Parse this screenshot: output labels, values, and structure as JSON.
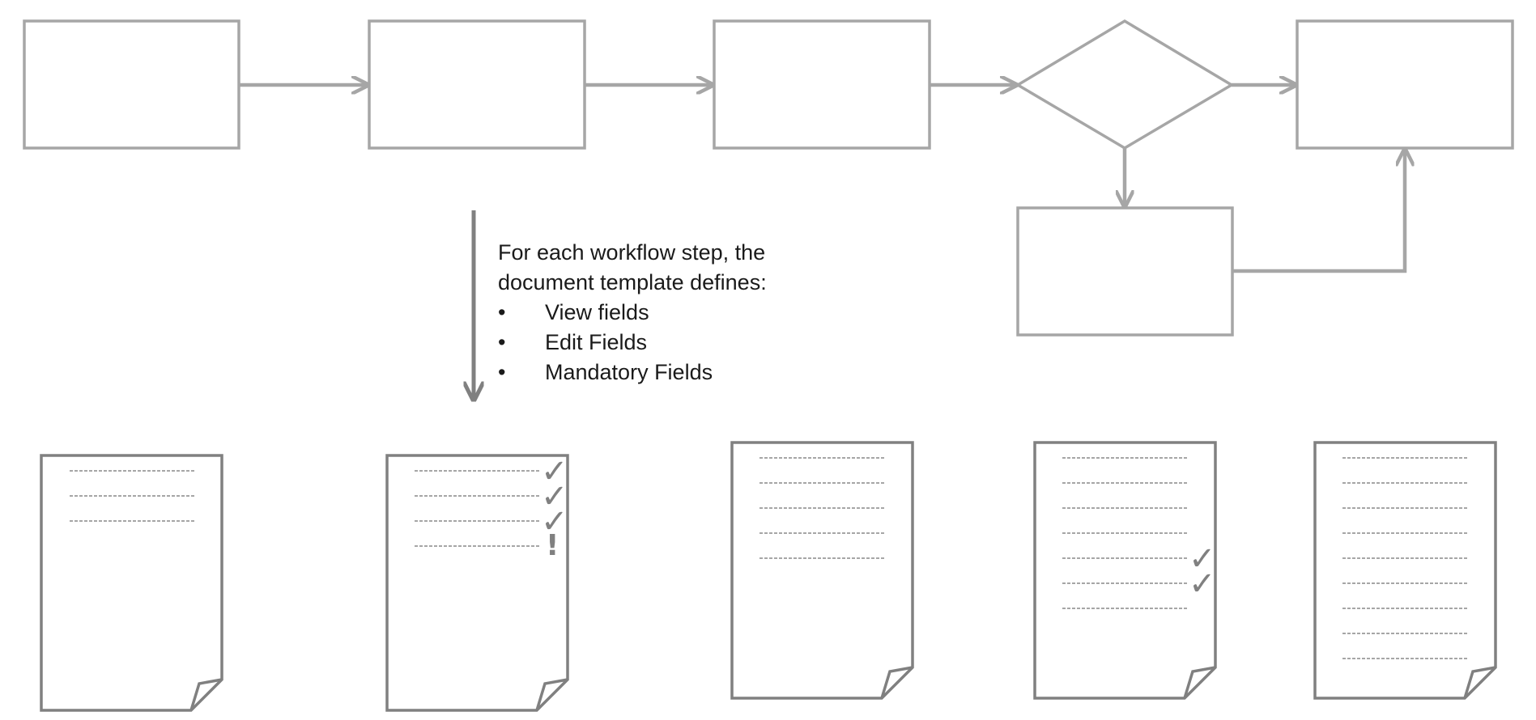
{
  "diagram": {
    "note": {
      "intro_line1": "For each workflow step, the",
      "intro_line2": "document template defines:",
      "bullet_glyph": "•",
      "bullets": [
        "View fields",
        "Edit Fields",
        "Mandatory Fields"
      ]
    },
    "marks": {
      "check": "✓",
      "warning": "!"
    },
    "colors": {
      "flow_stroke": "#a6a6a6",
      "doc_stroke": "#808080",
      "text": "#1a1a1a"
    }
  }
}
